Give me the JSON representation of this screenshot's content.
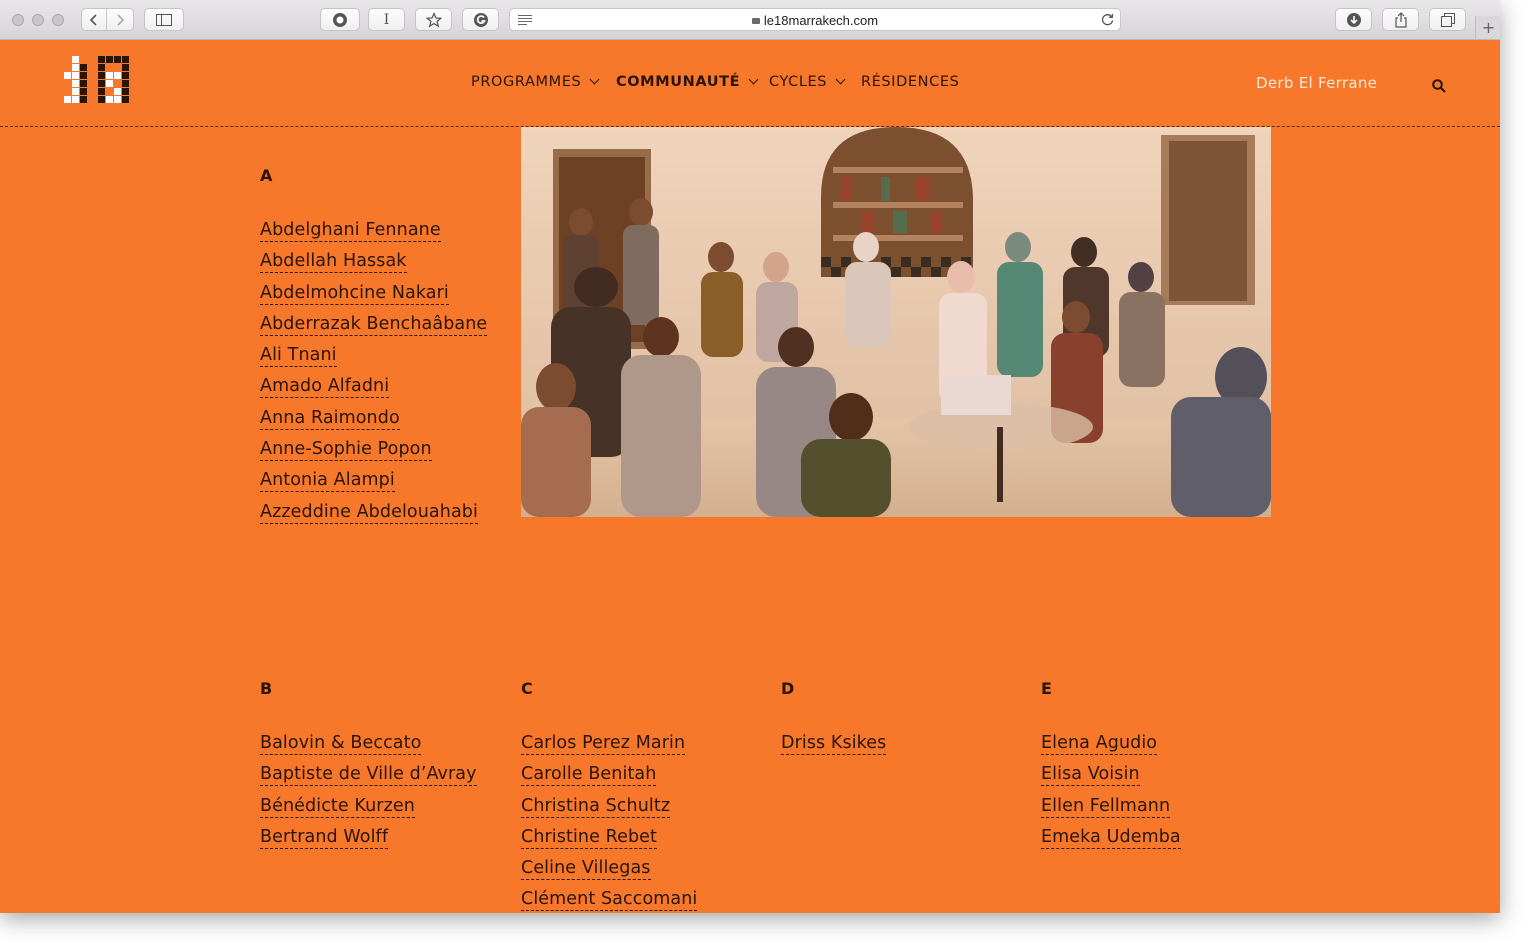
{
  "browser": {
    "url": "le18marrakech.com",
    "reader_label": "I"
  },
  "header": {
    "nav": [
      {
        "label": "PROGRAMMES",
        "dropdown": true,
        "active": false
      },
      {
        "label": "COMMUNAUTÉ",
        "dropdown": true,
        "active": true
      },
      {
        "label": "CYCLES",
        "dropdown": true,
        "active": false
      },
      {
        "label": "RÉSIDENCES",
        "dropdown": false,
        "active": false
      }
    ],
    "place": "Derb El Ferrane",
    "search_icon": "search-icon"
  },
  "colors": {
    "background": "#f7782a",
    "text": "#2a1406",
    "place_text": "#fde8d8"
  },
  "directory": {
    "a": {
      "letter": "A",
      "names": [
        "Abdelghani Fennane",
        "Abdellah Hassak",
        "Abdelmohcine Nakari",
        "Abderrazak Benchaâbane",
        "Ali Tnani",
        "Amado Alfadni",
        "Anna Raimondo",
        "Anne-Sophie Popon",
        "Antonia Alampi",
        "Azzeddine Abdelouahabi"
      ]
    },
    "b": {
      "letter": "B",
      "names": [
        "Balovin & Beccato",
        "Baptiste de Ville d’Avray",
        "Bénédicte Kurzen",
        "Bertrand Wolff"
      ]
    },
    "c": {
      "letter": "C",
      "names": [
        "Carlos Perez Marin",
        "Carolle Benitah",
        "Christina Schultz",
        "Christine Rebet",
        "Celine Villegas",
        "Clément Saccomani"
      ]
    },
    "d": {
      "letter": "D",
      "names": [
        "Driss Ksikes"
      ]
    },
    "e": {
      "letter": "E",
      "names": [
        "Elena Agudio",
        "Elisa Voisin",
        "Ellen Fellmann",
        "Emeka Udemba"
      ]
    }
  }
}
